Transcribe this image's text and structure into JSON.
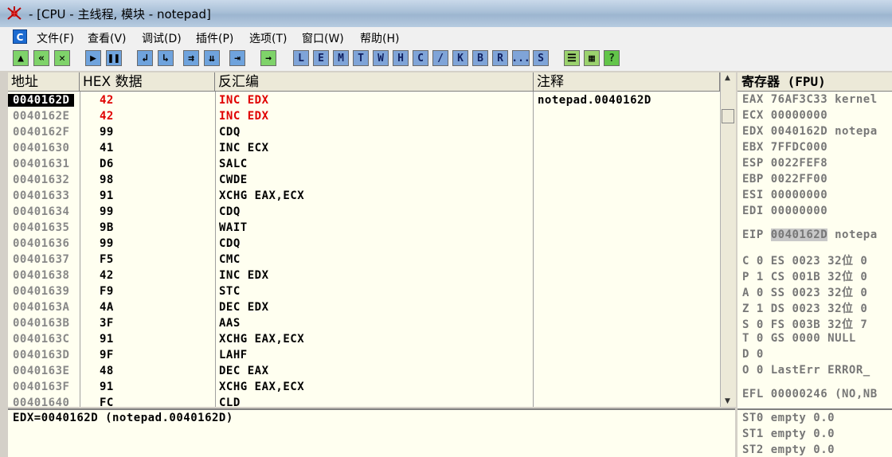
{
  "window": {
    "title": "- [CPU - 主线程, 模块 - notepad]"
  },
  "menu": [
    "文件(F)",
    "查看(V)",
    "调试(D)",
    "插件(P)",
    "选项(T)",
    "窗口(W)",
    "帮助(H)"
  ],
  "menu_logo": "C",
  "toolbar_letters": [
    "L",
    "E",
    "M",
    "T",
    "W",
    "H",
    "C",
    "/",
    "K",
    "B",
    "R",
    "...",
    "S"
  ],
  "help_label": "?",
  "columns": {
    "addr": "地址",
    "hex": "HEX 数据",
    "asm": "反汇编",
    "comment": "注释"
  },
  "disasm": [
    {
      "addr": "0040162D",
      "hex": "42",
      "asm": "INC EDX",
      "comment": "notepad.0040162D"
    },
    {
      "addr": "0040162E",
      "hex": "42",
      "asm": "INC EDX",
      "comment": ""
    },
    {
      "addr": "0040162F",
      "hex": "99",
      "asm": "CDQ",
      "comment": ""
    },
    {
      "addr": "00401630",
      "hex": "41",
      "asm": "INC ECX",
      "comment": ""
    },
    {
      "addr": "00401631",
      "hex": "D6",
      "asm": "SALC",
      "comment": ""
    },
    {
      "addr": "00401632",
      "hex": "98",
      "asm": "CWDE",
      "comment": ""
    },
    {
      "addr": "00401633",
      "hex": "91",
      "asm": "XCHG EAX,ECX",
      "comment": ""
    },
    {
      "addr": "00401634",
      "hex": "99",
      "asm": "CDQ",
      "comment": ""
    },
    {
      "addr": "00401635",
      "hex": "9B",
      "asm": "WAIT",
      "comment": ""
    },
    {
      "addr": "00401636",
      "hex": "99",
      "asm": "CDQ",
      "comment": ""
    },
    {
      "addr": "00401637",
      "hex": "F5",
      "asm": "CMC",
      "comment": ""
    },
    {
      "addr": "00401638",
      "hex": "42",
      "asm": "INC EDX",
      "comment": ""
    },
    {
      "addr": "00401639",
      "hex": "F9",
      "asm": "STC",
      "comment": ""
    },
    {
      "addr": "0040163A",
      "hex": "4A",
      "asm": "DEC EDX",
      "comment": ""
    },
    {
      "addr": "0040163B",
      "hex": "3F",
      "asm": "AAS",
      "comment": ""
    },
    {
      "addr": "0040163C",
      "hex": "91",
      "asm": "XCHG EAX,ECX",
      "comment": ""
    },
    {
      "addr": "0040163D",
      "hex": "9F",
      "asm": "LAHF",
      "comment": ""
    },
    {
      "addr": "0040163E",
      "hex": "48",
      "asm": "DEC EAX",
      "comment": ""
    },
    {
      "addr": "0040163F",
      "hex": "91",
      "asm": "XCHG EAX,ECX",
      "comment": ""
    },
    {
      "addr": "00401640",
      "hex": "FC",
      "asm": "CLD",
      "comment": ""
    }
  ],
  "info_line": "EDX=0040162D (notepad.0040162D)",
  "registers": {
    "header": "寄存器 (FPU)",
    "lines": [
      "EAX 76AF3C33 kernel",
      "ECX 00000000",
      "EDX 0040162D notepa",
      "EBX 7FFDC000",
      "ESP 0022FEF8",
      "EBP 0022FF00",
      "ESI 00000000",
      "EDI 00000000",
      "EIP 0040162D notepa",
      "C 0  ES 0023 32位 0",
      "P 1  CS 001B 32位 0",
      "A 0  SS 0023 32位 0",
      "Z 1  DS 0023 32位 0",
      "S 0  FS 003B 32位 7",
      "T 0  GS 0000 NULL",
      "D 0",
      "O 0  LastErr ERROR_",
      "EFL 00000246 (NO,NB",
      "ST0 empty 0.0",
      "ST1 empty 0.0",
      "ST2 empty 0.0"
    ]
  }
}
